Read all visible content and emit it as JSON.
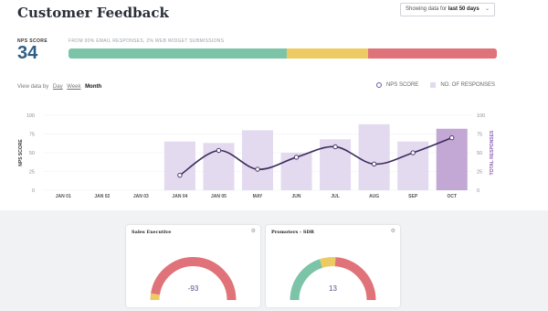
{
  "header": {
    "title": "Customer Feedback",
    "range_prefix": "Showing data for",
    "range_value": "last 50 days",
    "chevron_icon": "chevron-down-icon"
  },
  "nps": {
    "label": "NPS SCORE",
    "value": "34",
    "note": "FROM 90% EMAIL RESPONSES, 2% WEB WIDGET SUBMISSIONS",
    "segments": [
      {
        "name": "promoters",
        "share": 0.51,
        "color": "#7cc4a8"
      },
      {
        "name": "passives",
        "share": 0.19,
        "color": "#eecb62"
      },
      {
        "name": "detractors",
        "share": 0.3,
        "color": "#e07379"
      }
    ]
  },
  "view": {
    "label": "View data by",
    "options": [
      "Day",
      "Week",
      "Month"
    ],
    "active": "Month"
  },
  "legend": {
    "nps": "NPS SCORE",
    "responses": "NO. OF RESPONSES"
  },
  "chart_data": {
    "type": "bar",
    "categories": [
      "JAN 01",
      "JAN 02",
      "JAN 03",
      "JAN 04",
      "JAN 05",
      "MAY",
      "JUN",
      "JUL",
      "AUG",
      "SEP",
      "OCT"
    ],
    "bar_values": [
      65,
      63,
      80,
      50,
      68,
      88,
      65,
      82
    ],
    "line_values": [
      20,
      53,
      28,
      44,
      58,
      35,
      50,
      70
    ],
    "bar_color": "#e3daf0",
    "highlight_bar_color": "#c3a8d6",
    "line_color": "#3d2b5c",
    "ylabel": "NPS SCORE",
    "y2label": "TOTAL RESPONSES",
    "yticks": [
      0,
      25,
      50,
      75,
      100
    ],
    "ylim": [
      0,
      100
    ]
  },
  "cards": [
    {
      "title": "Sales Executive",
      "value": "-93",
      "segments": [
        0.05,
        0.95
      ],
      "colors": [
        "#eecb62",
        "#e07379"
      ],
      "settings_icon": "gear-icon"
    },
    {
      "title": "Promoters - SDR",
      "value": "13",
      "segments": [
        0.4,
        0.12,
        0.48
      ],
      "colors": [
        "#7cc4a8",
        "#eecb62",
        "#e07379"
      ],
      "settings_icon": "gear-icon"
    }
  ]
}
